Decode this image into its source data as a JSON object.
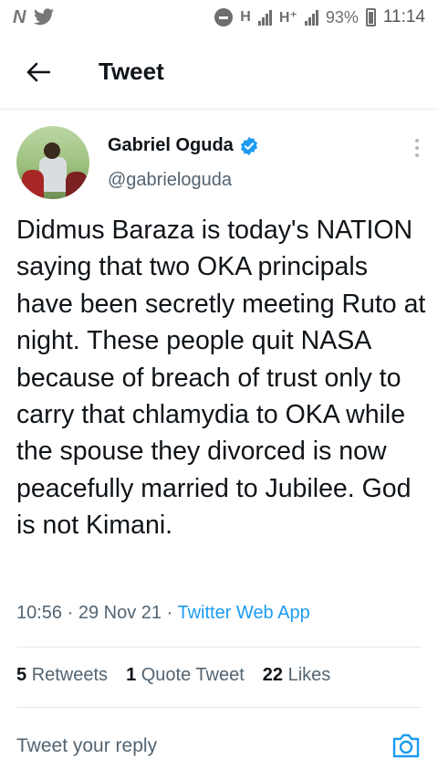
{
  "status_bar": {
    "left_icons": [
      "n-app-icon",
      "twitter-bird-icon"
    ],
    "network1": "H",
    "network2": "H⁺",
    "battery": "93%",
    "time": "11:14"
  },
  "header": {
    "title": "Tweet",
    "back_icon": "arrow-left-icon"
  },
  "author": {
    "name": "Gabriel Oguda",
    "handle": "@gabrieloguda",
    "verified": true
  },
  "tweet": {
    "text": "Didmus Baraza is today's NATION saying that two OKA principals have been secretly meeting Ruto at night. These people quit NASA because of breach of trust only to carry that chlamydia to OKA while the spouse they divorced is now peacefully married to Jubilee. God is not Kimani.",
    "time": "10:56",
    "date": "29 Nov 21",
    "source": "Twitter Web App",
    "sep": "·"
  },
  "stats": {
    "retweets_count": "5",
    "retweets_label": "Retweets",
    "quotes_count": "1",
    "quotes_label": "Quote Tweet",
    "likes_count": "22",
    "likes_label": "Likes"
  },
  "reply": {
    "placeholder": "Tweet your reply"
  },
  "colors": {
    "accent": "#1d9bf0",
    "muted": "#536471",
    "text": "#0f1419"
  }
}
